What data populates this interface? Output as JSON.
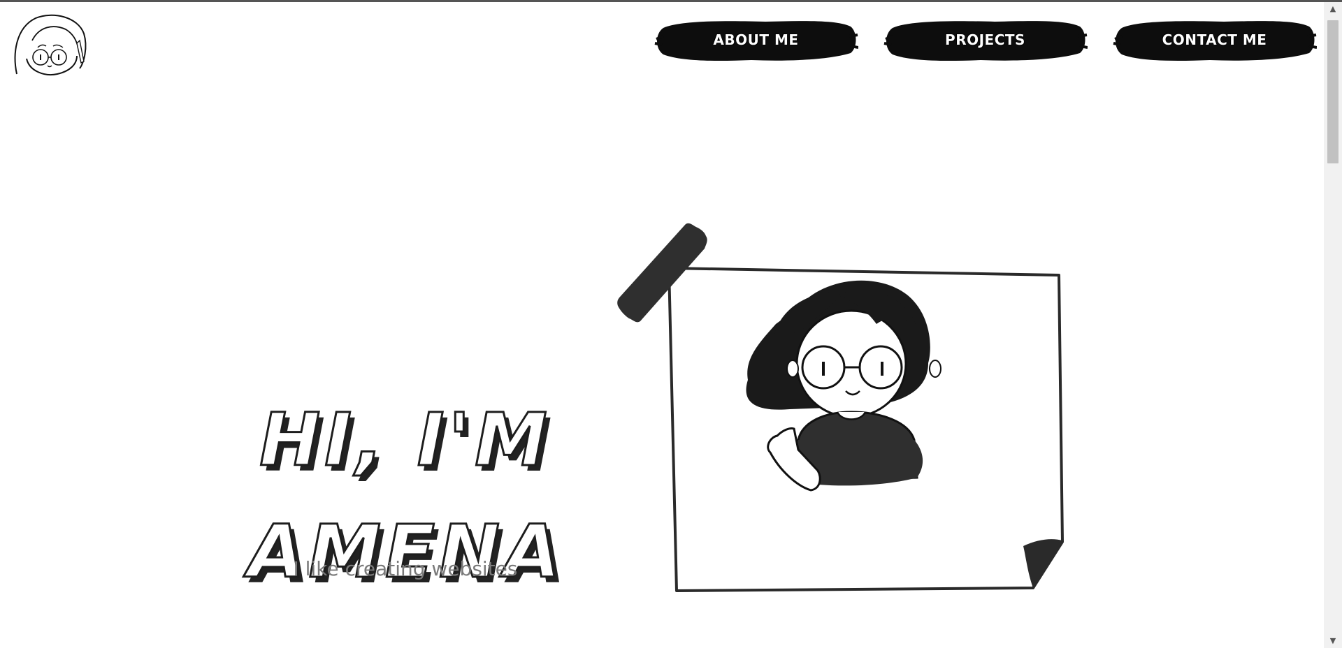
{
  "nav": {
    "items": [
      {
        "label": "ABOUT ME"
      },
      {
        "label": "PROJECTS"
      },
      {
        "label": "CONTACT ME"
      }
    ]
  },
  "hero": {
    "title_line1": "HI, I'M",
    "title_line2": "AMENA",
    "subtitle": "I like creating websites"
  },
  "colors": {
    "background": "#ffffff",
    "ink": "#1d1d1d",
    "brush": "#0d0d0d",
    "subtitle": "#7a7a7a"
  },
  "icons": {
    "logo": "girl-face-logo-icon",
    "illustration": "girl-portrait-illustration",
    "tape": "tape-icon"
  }
}
